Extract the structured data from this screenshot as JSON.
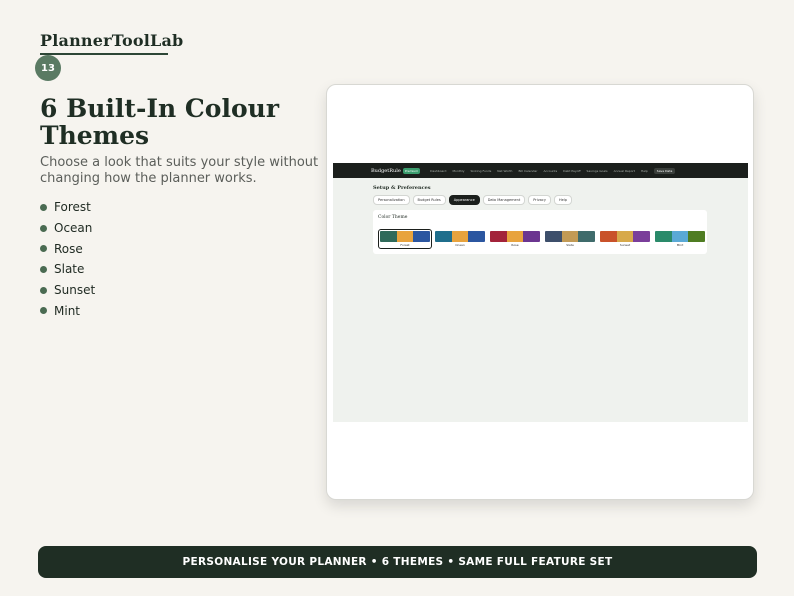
{
  "brand": "PlannerToolLab",
  "page_number": "13",
  "headline": "6 Built-In Colour Themes",
  "subtext": "Choose a look that suits your style without changing how the planner works.",
  "themes": [
    "Forest",
    "Ocean",
    "Rose",
    "Slate",
    "Sunset",
    "Mint"
  ],
  "app": {
    "logo": "BudgetRule",
    "badge": "Premium",
    "nav": [
      "Dashboard",
      "Monthly",
      "Sinking Funds",
      "Net Worth",
      "Bill Calendar",
      "Accounts",
      "Debt Payoff",
      "Savings Goals",
      "Annual Report",
      "Help"
    ],
    "nav_button": "Save Data",
    "page_title": "Setup & Preferences",
    "tabs": [
      "Personalization",
      "Budget Rules",
      "Appearance",
      "Data Management",
      "Privacy",
      "Help"
    ],
    "active_tab": "Appearance",
    "card_title": "Color Theme",
    "swatches": [
      {
        "name": "Forest",
        "colors": [
          "#2f6a5a",
          "#e8a33d",
          "#2b56a0"
        ],
        "selected": true
      },
      {
        "name": "Ocean",
        "colors": [
          "#1f6e8c",
          "#e8a33d",
          "#2b56a0"
        ],
        "selected": false
      },
      {
        "name": "Rose",
        "colors": [
          "#a3233a",
          "#e8a33d",
          "#6b3590"
        ],
        "selected": false
      },
      {
        "name": "Slate",
        "colors": [
          "#3d4f6b",
          "#c29a55",
          "#3f6b6b"
        ],
        "selected": false
      },
      {
        "name": "Sunset",
        "colors": [
          "#c9522a",
          "#d7a94a",
          "#7a3e9a"
        ],
        "selected": false
      },
      {
        "name": "Mint",
        "colors": [
          "#2a8a6a",
          "#5aa9d6",
          "#4f7d22"
        ],
        "selected": false
      }
    ]
  },
  "footer": "PERSONALISE YOUR PLANNER  •  6 THEMES  •  SAME FULL FEATURE SET"
}
